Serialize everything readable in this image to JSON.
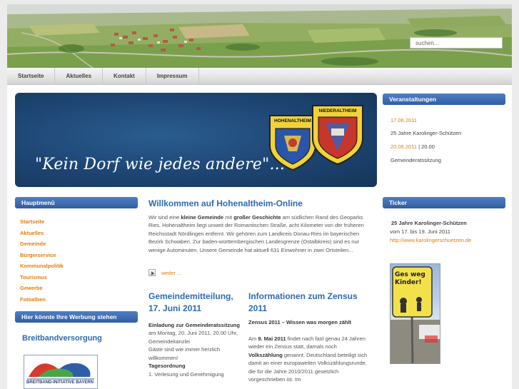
{
  "header": {
    "search_placeholder": "suchen..."
  },
  "nav": {
    "items": [
      "Startseite",
      "Aktuelles",
      "Kontakt",
      "Impressum"
    ]
  },
  "banner": {
    "slogan": "\"Kein Dorf wie jedes andere\"...",
    "crest_left": "HOHENALTHEIM",
    "crest_right": "NIEDERALTHEIM"
  },
  "sidebar": {
    "menu_title": "Hauptmenü",
    "menu_items": [
      "Startseite",
      "Aktuelles",
      "Gemeinde",
      "Bürgerservice",
      "Kommunalpolitik",
      "Tourismus",
      "Gewerbe",
      "Fotoalben"
    ],
    "ad_title": "Hier könnte Ihre Werbung stehen",
    "breitband_link": "Breitbandversorgung",
    "breitband_image_text": "BREITBAND-INITIATIVE BAYERN"
  },
  "main": {
    "welcome_title": "Willkommen auf Hohenaltheim-Online",
    "welcome": {
      "p1": "Wir sind eine ",
      "b1": "kleine Gemeinde",
      "p2": " mit ",
      "b2": "großer Geschichte",
      "p3": " am südlichen Rand des Geoparks Ries. Hohenaltheim liegt unweit der Romantischen Straße, acht Kilometer von der früheren Reichsstadt Nördlingen entfernt. Wir gehören zum Landkreis Donau-Ries im bayerischen Bezirk Schwaben. Zur baden-württembergischen Landesgrenze (Ostalbkreis) sind es nur wenige Autominuten. Unsere Gemeinde hat aktuell 631 Einwohner in zwei Ortsteilen..."
    },
    "weiter": "weiter ...",
    "col1_title": "Gemeindemitteilung, 17. Juni 2011",
    "col1": {
      "b1": "Einladung zur Gemeinderatssitzung",
      "t1": "am Montag, 20. Juni 2011, 20.00 Uhr, Gemeindekanzlei",
      "t2": "Gäste sind wie immer herzlich willkommen!",
      "b2": "Tagesordnung",
      "t3": "1.    Verlesung und Genehmigung"
    },
    "col2_title": "Informationen zum Zensus 2011",
    "col2": {
      "b1": "Zensus 2011 – Wissen was morgen zählt",
      "t1": "Am ",
      "b2": "9. Mai 2011",
      "t2": " findet nach fast genau 24 Jahren wieder ein Zensus statt, damals noch ",
      "b3": "Volkszählung",
      "t3": " genannt. Deutschland beteiligt sich damit an einer europaweiten Volkszählungsrunde, die für die Jahre 2010/2011 gesetzlich vorgeschrieben ist. Im"
    }
  },
  "right": {
    "events_title": "Veranstaltungen",
    "event1_date": "17.06.2011",
    "event1_text": "25 Jahre Karolinger-Schützen",
    "event2_date": "20.06.2011",
    "event2_sep": " | 20.00",
    "event2_text": "Gemeinderatssitzung",
    "ticker_title": "Ticker",
    "ticker_head": "25 Jahre Karolinger-Schützen",
    "ticker_text": "vom 17. bis 19. Juni 2011",
    "ticker_link": "http://www.karolingerschuetzen.de",
    "sign_text": "Ges weg Kinder!"
  },
  "colors": {
    "accent_blue": "#2f5ea6",
    "link_orange": "#e07d10",
    "title_blue": "#2e6ab0"
  }
}
